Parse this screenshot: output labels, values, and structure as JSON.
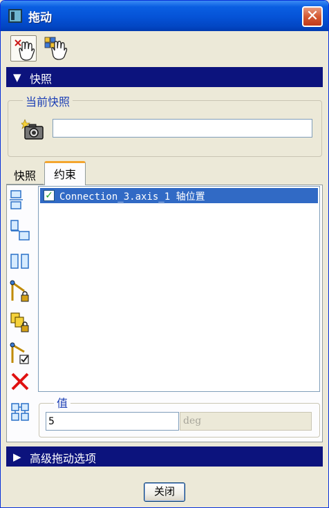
{
  "window": {
    "title": "拖动",
    "close_glyph": "✕"
  },
  "toolbar": {
    "buttons": [
      {
        "icon": "drag-hand-select-icon",
        "active": true
      },
      {
        "icon": "drag-hand-grid-icon",
        "active": false
      }
    ]
  },
  "snapshot_section": {
    "label": "快照",
    "group_label": "当前快照",
    "camera_icon": "camera-icon",
    "input_value": ""
  },
  "tabs": [
    {
      "label": "快照",
      "active": false
    },
    {
      "label": "约束",
      "active": true
    }
  ],
  "side_icons": [
    "align-top-icon",
    "align-offset-icon",
    "align-side-icon",
    "link-lock-icon",
    "body-lock-icon",
    "link-check-icon",
    "delete-x-icon",
    "grid-arrange-icon"
  ],
  "constraint_list": {
    "rows": [
      {
        "checked": true,
        "text": "Connection_3.axis_1 轴位置"
      }
    ]
  },
  "value_group": {
    "label": "值",
    "value": "5",
    "unit": "deg"
  },
  "advanced_section": {
    "label": "高级拖动选项"
  },
  "footer": {
    "close_label": "关闭"
  },
  "colors": {
    "title_bar": "#0552d6",
    "section_bar": "#0c137d",
    "selected_row": "#316ac5",
    "group_label": "#1c3fb5",
    "tab_highlight": "#f3a52e",
    "delete_icon": "#e01010"
  }
}
